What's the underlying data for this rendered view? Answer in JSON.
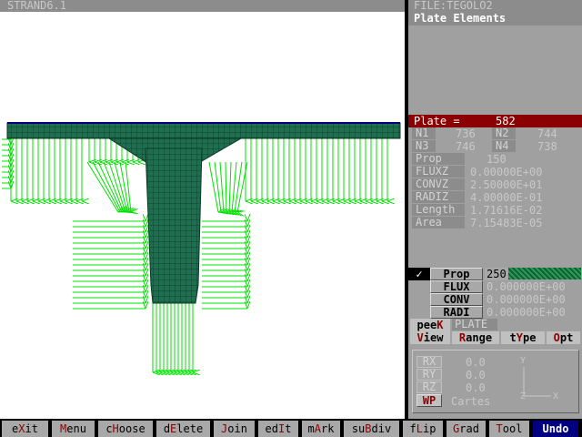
{
  "window": {
    "title": "STRAND6.1",
    "file": "FILE:TEGOLO2",
    "panel_title": "Plate Elements"
  },
  "plate": {
    "label": "Plate =",
    "number": "582",
    "nodes": [
      {
        "label": "N1",
        "value": "736"
      },
      {
        "label": "N2",
        "value": "744"
      },
      {
        "label": "N3",
        "value": "746"
      },
      {
        "label": "N4",
        "value": "738"
      }
    ],
    "props": [
      {
        "label": "Prop",
        "value": "150"
      },
      {
        "label": "FLUXZ",
        "value": "0.00000E+00"
      },
      {
        "label": "CONVZ",
        "value": "2.50000E+01"
      },
      {
        "label": "RADIZ",
        "value": "4.00000E-01"
      },
      {
        "label": "Length",
        "value": "1.71616E-02"
      },
      {
        "label": "Area",
        "value": "7.15483E-05"
      }
    ]
  },
  "assign": {
    "check": "✓",
    "rows": [
      {
        "label": "Prop",
        "value": "250"
      },
      {
        "label": "FLUX",
        "value": "0.000000E+00"
      },
      {
        "label": "CONV",
        "value": "0.000000E+00"
      },
      {
        "label": "RADI",
        "value": "0.000000E+00"
      }
    ]
  },
  "peek": {
    "label_a": "pee",
    "label_hk": "K",
    "value": "PLATE"
  },
  "tabs": [
    {
      "hk": "V",
      "rest": "iew"
    },
    {
      "hk": "R",
      "rest": "ange"
    },
    {
      "pre": "t",
      "hk": "Y",
      "rest": "pe"
    },
    {
      "hk": "O",
      "rest": "pt"
    }
  ],
  "view": {
    "rows": [
      {
        "label": "RX",
        "value": "0.0"
      },
      {
        "label": "RY",
        "value": "0.0"
      },
      {
        "label": "RZ",
        "value": "0.0"
      },
      {
        "label": "WP",
        "value": "Cartes"
      }
    ],
    "axis_y": "Y",
    "axis_z": "Z",
    "axis_x": "X"
  },
  "menu": [
    {
      "pre": "e",
      "hk": "X",
      "rest": "it"
    },
    {
      "pre": "",
      "hk": "M",
      "rest": "enu"
    },
    {
      "pre": "c",
      "hk": "H",
      "rest": "oose"
    },
    {
      "pre": "d",
      "hk": "E",
      "rest": "lete"
    },
    {
      "pre": "",
      "hk": "J",
      "rest": "oin"
    },
    {
      "pre": "ed",
      "hk": "I",
      "rest": "t"
    },
    {
      "pre": "m",
      "hk": "A",
      "rest": "rk"
    },
    {
      "pre": "su",
      "hk": "B",
      "rest": "div"
    },
    {
      "pre": "f",
      "hk": "L",
      "rest": "ip"
    },
    {
      "pre": "",
      "hk": "G",
      "rest": "rad"
    },
    {
      "pre": "",
      "hk": "T",
      "rest": "ool"
    },
    {
      "pre": "",
      "hk": "",
      "rest": "Undo"
    }
  ],
  "colors": {
    "mesh": "#1e6e50",
    "arrows": "#00e000",
    "plate_bar": "#8b0000"
  }
}
